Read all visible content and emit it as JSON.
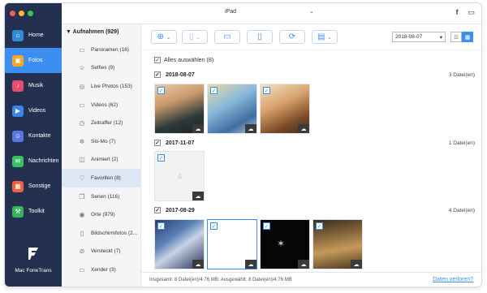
{
  "window": {
    "traffic_colors": [
      "#fc5b57",
      "#fdbc2e",
      "#34c84a"
    ]
  },
  "sidebar": {
    "items": [
      {
        "label": "Home",
        "icon": "home-icon",
        "color": "#2f8bd6"
      },
      {
        "label": "Fotos",
        "icon": "photos-icon",
        "color": "#f5a623"
      },
      {
        "label": "Musik",
        "icon": "music-icon",
        "color": "#e84c6c"
      },
      {
        "label": "Videos",
        "icon": "video-icon",
        "color": "#3a86e8"
      },
      {
        "label": "Kontakte",
        "icon": "contacts-icon",
        "color": "#5a75e0"
      },
      {
        "label": "Nachrichten",
        "icon": "messages-icon",
        "color": "#37c25f"
      },
      {
        "label": "Sonstige",
        "icon": "other-icon",
        "color": "#f0613c"
      },
      {
        "label": "Toolkit",
        "icon": "toolkit-icon",
        "color": "#36b25a"
      }
    ],
    "active_index": 1,
    "brand": "Mac FoneTrans"
  },
  "topbar": {
    "device": "iPad"
  },
  "categories": {
    "header": "Aufnahmen (929)",
    "items": [
      {
        "label": "Panoramen (16)",
        "icon": "panorama-icon"
      },
      {
        "label": "Selfies (9)",
        "icon": "selfie-icon"
      },
      {
        "label": "Live Photos (153)",
        "icon": "live-photo-icon"
      },
      {
        "label": "Videos (62)",
        "icon": "video-icon"
      },
      {
        "label": "Zeitraffer (12)",
        "icon": "timelapse-icon"
      },
      {
        "label": "Slo-Mo (7)",
        "icon": "slomo-icon"
      },
      {
        "label": "Animiert (2)",
        "icon": "animated-icon"
      },
      {
        "label": "Favoriten (8)",
        "icon": "heart-icon"
      },
      {
        "label": "Serien (116)",
        "icon": "burst-icon"
      },
      {
        "label": "Orte (979)",
        "icon": "location-icon"
      },
      {
        "label": "Bildschirmfotos (2...",
        "icon": "screenshot-icon"
      },
      {
        "label": "Versteckt (7)",
        "icon": "hidden-icon"
      },
      {
        "label": "Xender (3)",
        "icon": "album-icon"
      }
    ],
    "active_index": 7
  },
  "toolbar": {
    "date_value": "2018-08-07"
  },
  "content": {
    "select_all": "Alles auswählen (8)",
    "groups": [
      {
        "date": "2018-08-07",
        "count": "3 Datei(en)"
      },
      {
        "date": "2017-11-07",
        "count": "1 Datei(en)"
      },
      {
        "date": "2017-08-29",
        "count": "4 Datei(en)"
      }
    ]
  },
  "footer": {
    "summary": "Insgesamt: 8 Datei(en)/4.76 MB; Ausgewählt: 8 Datei(en)/4.76 MB",
    "link": "Daten verloren?"
  }
}
